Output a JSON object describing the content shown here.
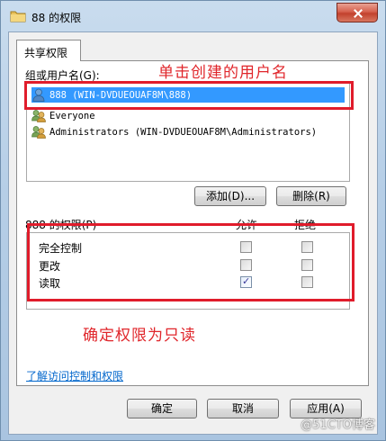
{
  "window": {
    "title": "88 的权限"
  },
  "tab": {
    "label": "共享权限"
  },
  "users": {
    "label": "组或用户名(G):",
    "items": [
      {
        "name": "888 (WIN-DVDUEOUAF8M\\888)"
      },
      {
        "name": "Everyone"
      },
      {
        "name": "Administrators (WIN-DVDUEOUAF8M\\Administrators)"
      }
    ]
  },
  "buttons": {
    "add": "添加(D)...",
    "remove": "删除(R)",
    "ok": "确定",
    "cancel": "取消",
    "apply": "应用(A)"
  },
  "permissions": {
    "label": "888 的权限(P)",
    "allow_header": "允许",
    "deny_header": "拒绝",
    "rows": [
      {
        "name": "完全控制",
        "allow": false,
        "deny": false
      },
      {
        "name": "更改",
        "allow": false,
        "deny": false
      },
      {
        "name": "读取",
        "allow": true,
        "deny": false
      }
    ]
  },
  "link": "了解访问控制和权限",
  "annotations": {
    "top": "单击创建的用户名",
    "bottom": "确定权限为只读"
  },
  "watermark": "@51CTO博客",
  "colors": {
    "annotation": "#e0262b",
    "selection": "#3399ff",
    "link": "#0066cc"
  }
}
